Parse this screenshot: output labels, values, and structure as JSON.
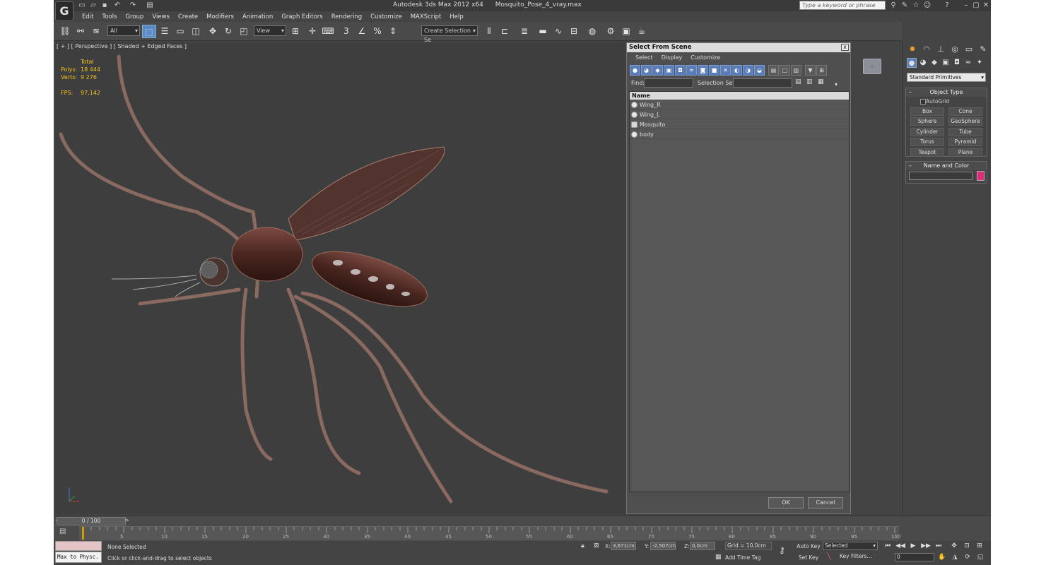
{
  "titlebar": {
    "app_name": "Autodesk 3ds Max  2012 x64",
    "file_name": "Mosquito_Pose_4_vray.max",
    "search_placeholder": "Type a keyword or phrase"
  },
  "menus": [
    "Edit",
    "Tools",
    "Group",
    "Views",
    "Create",
    "Modifiers",
    "Animation",
    "Graph Editors",
    "Rendering",
    "Customize",
    "MAXScript",
    "Help"
  ],
  "toolbar": {
    "filter_value": "All",
    "coord_system": "View",
    "selection_set_placeholder": "Create Selection Se"
  },
  "viewport": {
    "label": "[ + ] [ Perspective ] [ Shaded + Edged Faces ]",
    "stats": {
      "total_label": "Total",
      "polys_label": "Polys:",
      "polys_value": "18 444",
      "verts_label": "Verts:",
      "verts_value": "9 276",
      "fps_label": "FPS:",
      "fps_value": "97,142"
    }
  },
  "dialog": {
    "title": "Select From Scene",
    "close_label": "x",
    "menus": [
      "Select",
      "Display",
      "Customize"
    ],
    "find_label": "Find:",
    "selection_set_label": "Selection Set:",
    "column_name": "Name",
    "objects": [
      "Wing_R",
      "Wing_L",
      "Mosquito",
      "body"
    ],
    "ok_label": "OK",
    "cancel_label": "Cancel"
  },
  "command_panel": {
    "category": "Standard Primitives",
    "object_type_title": "Object Type",
    "autogrid_label": "AutoGrid",
    "primitives": [
      "Box",
      "Cone",
      "Sphere",
      "GeoSphere",
      "Cylinder",
      "Tube",
      "Torus",
      "Pyramid",
      "Teapot",
      "Plane"
    ],
    "name_color_title": "Name and Color",
    "object_color": "#e02a7a"
  },
  "timeline": {
    "slider_text": "0 / 100",
    "ticks": [
      "5",
      "10",
      "15",
      "20",
      "25",
      "30",
      "35",
      "40",
      "45",
      "50",
      "55",
      "60",
      "65",
      "70",
      "75",
      "80",
      "85",
      "90",
      "95",
      "100"
    ]
  },
  "status": {
    "maxscript_text": "Max to Physc.",
    "selection_text": "None Selected",
    "prompt_text": "Click or click-and-drag to select objects",
    "x_label": "X:",
    "x_value": "3,671cm",
    "y_label": "Y:",
    "y_value": "-2,507cm",
    "z_label": "Z:",
    "z_value": "0,0cm",
    "grid_text": "Grid = 10,0cm",
    "add_time_tag": "Add Time Tag",
    "auto_key": "Auto Key",
    "set_key": "Set Key",
    "selected_option": "Selected",
    "key_filters": "Key Filters...",
    "frame_value": "0"
  }
}
